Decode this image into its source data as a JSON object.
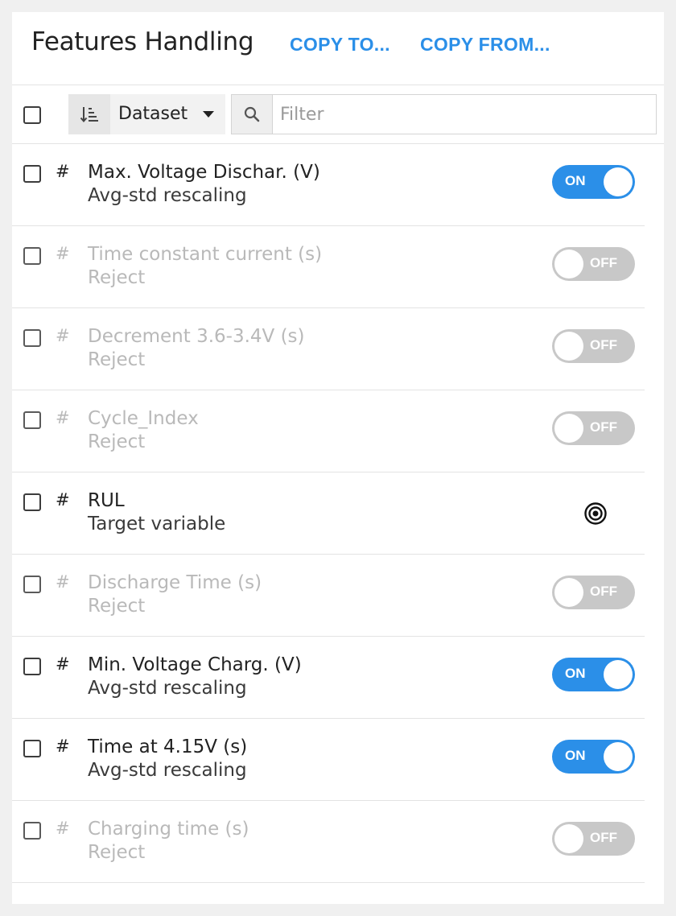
{
  "header": {
    "title": "Features Handling",
    "copy_to_label": "COPY TO...",
    "copy_from_label": "COPY FROM..."
  },
  "toolbar": {
    "sort_icon": "sort-icon",
    "dataset_select_value": "Dataset",
    "filter_placeholder": "Filter",
    "search_icon": "search-icon"
  },
  "colors": {
    "accent": "#2b8fe8",
    "toggle_off": "#c8c8c8",
    "rejected_text": "#b9b9b9"
  },
  "features": [
    {
      "type_symbol": "#",
      "name": "Max. Voltage Dischar. (V)",
      "handling": "Avg-std rescaling",
      "control": "toggle",
      "state_label": "ON"
    },
    {
      "type_symbol": "#",
      "name": "Time constant current (s)",
      "handling": "Reject",
      "control": "toggle",
      "state_label": "OFF"
    },
    {
      "type_symbol": "#",
      "name": "Decrement 3.6-3.4V (s)",
      "handling": "Reject",
      "control": "toggle",
      "state_label": "OFF"
    },
    {
      "type_symbol": "#",
      "name": "Cycle_Index",
      "handling": "Reject",
      "control": "toggle",
      "state_label": "OFF"
    },
    {
      "type_symbol": "#",
      "name": "RUL",
      "handling": "Target variable",
      "control": "target-icon",
      "state_label": ""
    },
    {
      "type_symbol": "#",
      "name": "Discharge Time (s)",
      "handling": "Reject",
      "control": "toggle",
      "state_label": "OFF"
    },
    {
      "type_symbol": "#",
      "name": "Min. Voltage Charg. (V)",
      "handling": "Avg-std rescaling",
      "control": "toggle",
      "state_label": "ON"
    },
    {
      "type_symbol": "#",
      "name": "Time at 4.15V (s)",
      "handling": "Avg-std rescaling",
      "control": "toggle",
      "state_label": "ON"
    },
    {
      "type_symbol": "#",
      "name": "Charging time (s)",
      "handling": "Reject",
      "control": "toggle",
      "state_label": "OFF"
    }
  ]
}
